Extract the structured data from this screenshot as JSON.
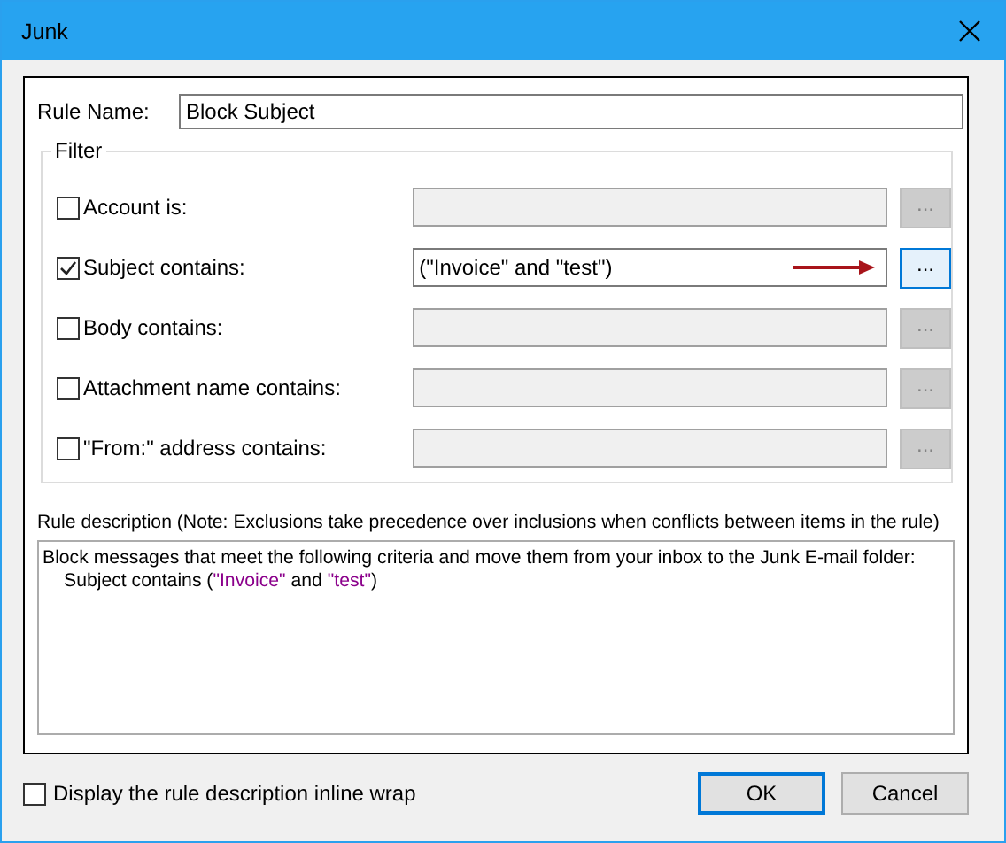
{
  "window": {
    "title": "Junk"
  },
  "rule_name": {
    "label": "Rule Name:",
    "value": "Block Subject"
  },
  "filter": {
    "title": "Filter",
    "rows": [
      {
        "label": "Account is:",
        "checked": false,
        "disabled": true,
        "value": "",
        "button": "...",
        "arrow": false
      },
      {
        "label": "Subject contains:",
        "checked": true,
        "disabled": false,
        "value": "(\"Invoice\" and \"test\")",
        "button": "...",
        "arrow": true
      },
      {
        "label": "Body contains:",
        "checked": false,
        "disabled": true,
        "value": "",
        "button": "...",
        "arrow": false
      },
      {
        "label": "Attachment name contains:",
        "checked": false,
        "disabled": true,
        "value": "",
        "button": "...",
        "arrow": false
      },
      {
        "label": "\"From:\" address contains:",
        "checked": false,
        "disabled": true,
        "value": "",
        "button": "...",
        "arrow": false
      }
    ]
  },
  "description": {
    "label": "Rule description (Note: Exclusions take precedence over inclusions when conflicts between items in the rule)",
    "lines": [
      {
        "indent": false,
        "segments": [
          {
            "kind": "plain",
            "text": "Block messages that meet the following criteria and move them from your inbox to the Junk E-mail folder:"
          }
        ]
      },
      {
        "indent": true,
        "segments": [
          {
            "kind": "plain",
            "text": "Subject contains ("
          },
          {
            "kind": "value",
            "text": "\"Invoice\""
          },
          {
            "kind": "plain",
            "text": " and "
          },
          {
            "kind": "value",
            "text": "\"test\""
          },
          {
            "kind": "plain",
            "text": ")"
          }
        ]
      }
    ]
  },
  "inline_wrap": {
    "label": "Display the rule description inline wrap",
    "checked": false
  },
  "buttons": [
    {
      "label": "OK",
      "default": true
    },
    {
      "label": "Cancel",
      "default": false
    }
  ]
}
